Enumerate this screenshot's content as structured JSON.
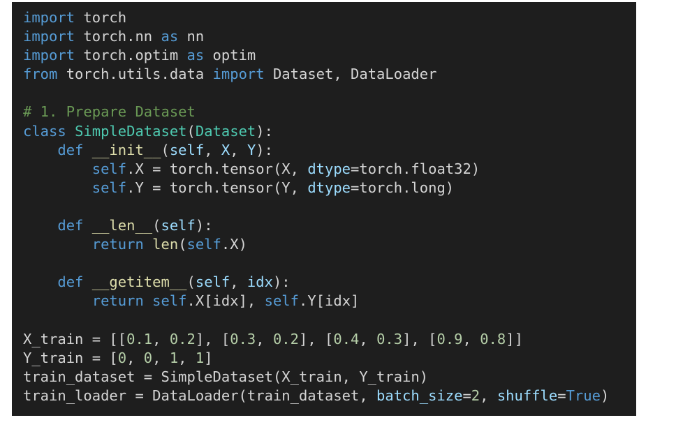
{
  "editor": {
    "theme": {
      "background": "#1e1e1e",
      "default": "#d4d4d4",
      "keyword": "#569cd6",
      "class": "#4ec9b0",
      "function": "#dcdcaa",
      "parameter": "#9cdcfe",
      "number": "#b5cea8",
      "comment": "#6a9955"
    },
    "lines": [
      [
        {
          "t": "import",
          "k": "kw"
        },
        {
          "t": " torch",
          "k": "plain"
        }
      ],
      [
        {
          "t": "import",
          "k": "kw"
        },
        {
          "t": " torch.nn ",
          "k": "plain"
        },
        {
          "t": "as",
          "k": "kw"
        },
        {
          "t": " nn",
          "k": "plain"
        }
      ],
      [
        {
          "t": "import",
          "k": "kw"
        },
        {
          "t": " torch.optim ",
          "k": "plain"
        },
        {
          "t": "as",
          "k": "kw"
        },
        {
          "t": " optim",
          "k": "plain"
        }
      ],
      [
        {
          "t": "from",
          "k": "kw"
        },
        {
          "t": " torch.utils.data ",
          "k": "plain"
        },
        {
          "t": "import",
          "k": "kw"
        },
        {
          "t": " Dataset, DataLoader",
          "k": "plain"
        }
      ],
      [],
      [
        {
          "t": "# 1. Prepare Dataset",
          "k": "comment"
        }
      ],
      [
        {
          "t": "class",
          "k": "kw"
        },
        {
          "t": " ",
          "k": "plain"
        },
        {
          "t": "SimpleDataset",
          "k": "class"
        },
        {
          "t": "(",
          "k": "plain"
        },
        {
          "t": "Dataset",
          "k": "class"
        },
        {
          "t": "):",
          "k": "plain"
        }
      ],
      [
        {
          "t": "    ",
          "k": "plain"
        },
        {
          "t": "def",
          "k": "kw"
        },
        {
          "t": " ",
          "k": "plain"
        },
        {
          "t": "__init__",
          "k": "func"
        },
        {
          "t": "(",
          "k": "plain"
        },
        {
          "t": "self",
          "k": "param"
        },
        {
          "t": ", ",
          "k": "plain"
        },
        {
          "t": "X",
          "k": "param"
        },
        {
          "t": ", ",
          "k": "plain"
        },
        {
          "t": "Y",
          "k": "param"
        },
        {
          "t": "):",
          "k": "plain"
        }
      ],
      [
        {
          "t": "        ",
          "k": "plain"
        },
        {
          "t": "self",
          "k": "self"
        },
        {
          "t": ".X = torch.tensor(X, ",
          "k": "plain"
        },
        {
          "t": "dtype",
          "k": "param"
        },
        {
          "t": "=torch.float32)",
          "k": "plain"
        }
      ],
      [
        {
          "t": "        ",
          "k": "plain"
        },
        {
          "t": "self",
          "k": "self"
        },
        {
          "t": ".Y = torch.tensor(Y, ",
          "k": "plain"
        },
        {
          "t": "dtype",
          "k": "param"
        },
        {
          "t": "=torch.long)",
          "k": "plain"
        }
      ],
      [],
      [
        {
          "t": "    ",
          "k": "plain"
        },
        {
          "t": "def",
          "k": "kw"
        },
        {
          "t": " ",
          "k": "plain"
        },
        {
          "t": "__len__",
          "k": "func"
        },
        {
          "t": "(",
          "k": "plain"
        },
        {
          "t": "self",
          "k": "param"
        },
        {
          "t": "):",
          "k": "plain"
        }
      ],
      [
        {
          "t": "        ",
          "k": "plain"
        },
        {
          "t": "return",
          "k": "kw"
        },
        {
          "t": " ",
          "k": "plain"
        },
        {
          "t": "len",
          "k": "func"
        },
        {
          "t": "(",
          "k": "plain"
        },
        {
          "t": "self",
          "k": "self"
        },
        {
          "t": ".X)",
          "k": "plain"
        }
      ],
      [],
      [
        {
          "t": "    ",
          "k": "plain"
        },
        {
          "t": "def",
          "k": "kw"
        },
        {
          "t": " ",
          "k": "plain"
        },
        {
          "t": "__getitem__",
          "k": "func"
        },
        {
          "t": "(",
          "k": "plain"
        },
        {
          "t": "self",
          "k": "param"
        },
        {
          "t": ", ",
          "k": "plain"
        },
        {
          "t": "idx",
          "k": "param"
        },
        {
          "t": "):",
          "k": "plain"
        }
      ],
      [
        {
          "t": "        ",
          "k": "plain"
        },
        {
          "t": "return",
          "k": "kw"
        },
        {
          "t": " ",
          "k": "plain"
        },
        {
          "t": "self",
          "k": "self"
        },
        {
          "t": ".X[idx], ",
          "k": "plain"
        },
        {
          "t": "self",
          "k": "self"
        },
        {
          "t": ".Y[idx]",
          "k": "plain"
        }
      ],
      [],
      [
        {
          "t": "X_train = [[",
          "k": "plain"
        },
        {
          "t": "0.1",
          "k": "num"
        },
        {
          "t": ", ",
          "k": "plain"
        },
        {
          "t": "0.2",
          "k": "num"
        },
        {
          "t": "], [",
          "k": "plain"
        },
        {
          "t": "0.3",
          "k": "num"
        },
        {
          "t": ", ",
          "k": "plain"
        },
        {
          "t": "0.2",
          "k": "num"
        },
        {
          "t": "], [",
          "k": "plain"
        },
        {
          "t": "0.4",
          "k": "num"
        },
        {
          "t": ", ",
          "k": "plain"
        },
        {
          "t": "0.3",
          "k": "num"
        },
        {
          "t": "], [",
          "k": "plain"
        },
        {
          "t": "0.9",
          "k": "num"
        },
        {
          "t": ", ",
          "k": "plain"
        },
        {
          "t": "0.8",
          "k": "num"
        },
        {
          "t": "]]",
          "k": "plain"
        }
      ],
      [
        {
          "t": "Y_train = [",
          "k": "plain"
        },
        {
          "t": "0",
          "k": "num"
        },
        {
          "t": ", ",
          "k": "plain"
        },
        {
          "t": "0",
          "k": "num"
        },
        {
          "t": ", ",
          "k": "plain"
        },
        {
          "t": "1",
          "k": "num"
        },
        {
          "t": ", ",
          "k": "plain"
        },
        {
          "t": "1",
          "k": "num"
        },
        {
          "t": "]",
          "k": "plain"
        }
      ],
      [
        {
          "t": "train_dataset = SimpleDataset(X_train, Y_train)",
          "k": "plain"
        }
      ],
      [
        {
          "t": "train_loader = DataLoader(train_dataset, ",
          "k": "plain"
        },
        {
          "t": "batch_size",
          "k": "param"
        },
        {
          "t": "=",
          "k": "plain"
        },
        {
          "t": "2",
          "k": "num"
        },
        {
          "t": ", ",
          "k": "plain"
        },
        {
          "t": "shuffle",
          "k": "param"
        },
        {
          "t": "=",
          "k": "plain"
        },
        {
          "t": "True",
          "k": "const"
        },
        {
          "t": ")",
          "k": "plain"
        }
      ]
    ]
  }
}
